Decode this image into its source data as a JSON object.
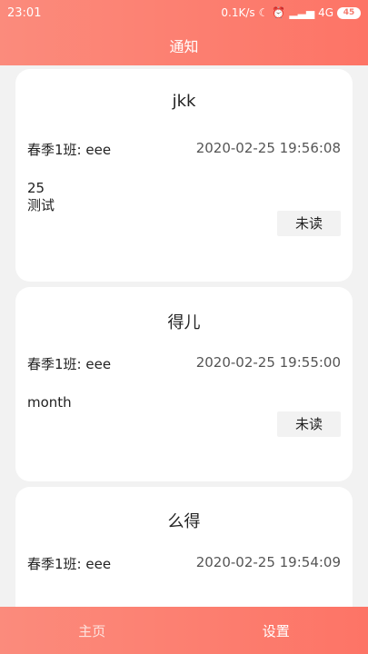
{
  "status": {
    "time": "23:01",
    "speed": "0.1K/s",
    "network": "4G",
    "battery": "45"
  },
  "header": {
    "title": "通知"
  },
  "notifications": [
    {
      "title": "jkk",
      "class_name": "春季1班: eee",
      "time": "2020-02-25 19:56:08",
      "content": "25\n测试",
      "status_label": "未读"
    },
    {
      "title": "得儿",
      "class_name": "春季1班: eee",
      "time": "2020-02-25 19:55:00",
      "content": "month",
      "status_label": "未读"
    },
    {
      "title": "么得",
      "class_name": "春季1班: eee",
      "time": "2020-02-25 19:54:09",
      "content": "",
      "status_label": ""
    }
  ],
  "tabbar": {
    "home_label": "主页",
    "settings_label": "设置"
  },
  "colors": {
    "accent_start": "#fb8b7c",
    "accent_end": "#fd7466"
  }
}
